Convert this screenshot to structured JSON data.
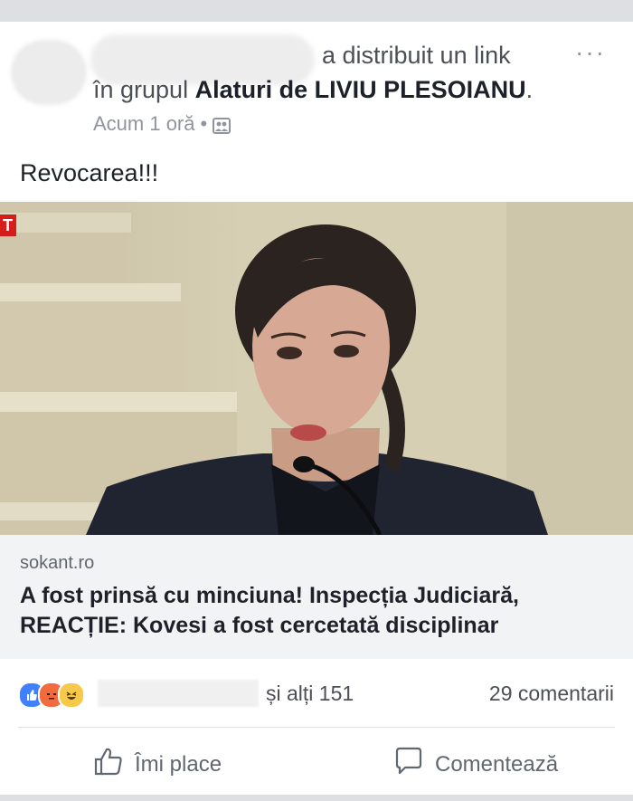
{
  "post": {
    "shared_text": "a distribuit un link",
    "in_group_prefix": "în grupul",
    "group_name": "Alaturi de LIVIU PLESOIANU",
    "group_suffix": ".",
    "time": "Acum 1 oră",
    "separator": "•",
    "privacy_icon": "group-privacy-icon",
    "more_label": "···",
    "message": "Revocarea!!!"
  },
  "photo": {
    "corner_tag": "T"
  },
  "link": {
    "domain": "sokant.ro",
    "title": "A fost prinsă cu minciuna! Inspecția Judiciară, REACȚIE: Kovesi a fost cercetată disciplinar"
  },
  "reactions": {
    "types": [
      "like",
      "angry",
      "haha"
    ],
    "others": "și alți 151",
    "comments": "29 comentarii"
  },
  "actions": {
    "like_label": "Îmi place",
    "comment_label": "Comentează"
  },
  "colors": {
    "link_bg": "#f2f3f5",
    "like_blue": "#4080ff",
    "angry_orange": "#f26b3c",
    "haha_yellow": "#f7c94a"
  }
}
